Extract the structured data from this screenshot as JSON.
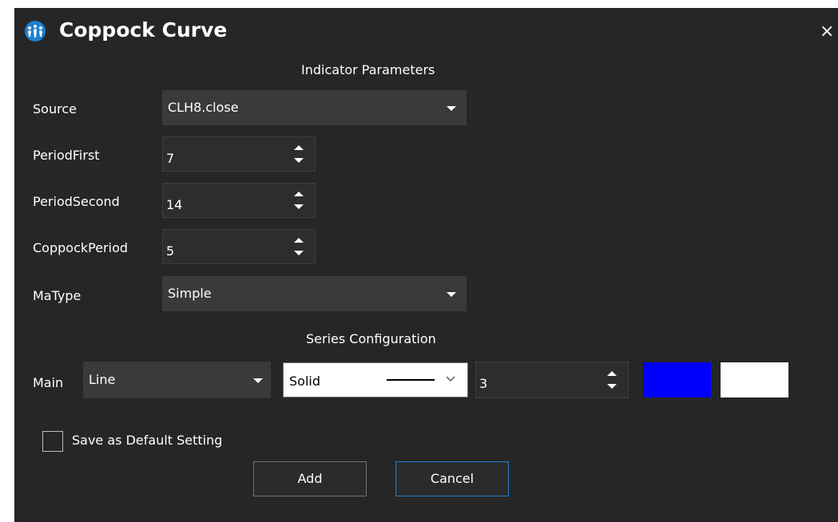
{
  "window": {
    "title": "Coppock Curve",
    "logo_icon": "multi-figure-logo-icon",
    "close_label": "×",
    "colors": {
      "background": "#262626",
      "field": "#3a3a3a",
      "accent": "#1f7fd3"
    }
  },
  "indicator_section": {
    "heading": "Indicator Parameters",
    "source": {
      "label": "Source",
      "value": "CLH8.close"
    },
    "period_first": {
      "label": "PeriodFirst",
      "value": "7"
    },
    "period_second": {
      "label": "PeriodSecond",
      "value": "14"
    },
    "coppock_period": {
      "label": "CoppockPeriod",
      "value": "5"
    },
    "ma_type": {
      "label": "MaType",
      "value": "Simple"
    }
  },
  "series_section": {
    "heading": "Series Configuration",
    "main": {
      "label": "Main",
      "series_type": "Line",
      "line_style": "Solid",
      "line_width": "3",
      "line_color": "#0000ff",
      "fill_color": "#ffffff"
    }
  },
  "footer": {
    "save_default_label": "Save as Default Setting",
    "save_default_checked": false,
    "add_label": "Add",
    "cancel_label": "Cancel"
  }
}
